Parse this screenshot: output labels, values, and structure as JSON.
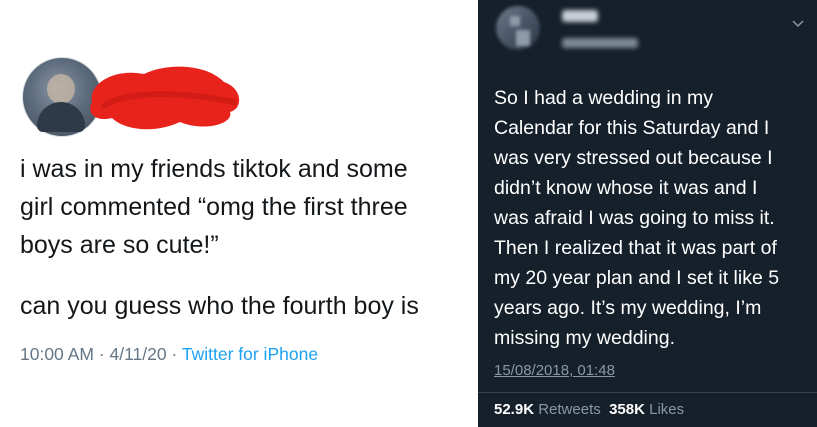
{
  "left_tweet": {
    "text_line1": "i was in my friends tiktok and some",
    "text_line2": "girl commented “omg the first three",
    "text_line3": "boys are so cute!”",
    "text_para2": "can you guess who the fourth boy is",
    "time": "10:00 AM",
    "separator": "·",
    "date": "4/11/20",
    "source": "Twitter for iPhone",
    "redaction_color": "#e8231c",
    "link_color": "#1da1f2"
  },
  "right_tweet": {
    "text_lines": [
      "So I had a wedding in my",
      "Calendar for this Saturday and I",
      "was very stressed out because I",
      "didn’t know whose it was and I",
      "was afraid I was going to miss it.",
      "Then I realized that it was part of",
      "my 20 year plan and I set it like 5",
      "years ago. It’s my wedding, I’m",
      "missing my wedding."
    ],
    "timestamp": "15/08/2018, 01:48",
    "retweets_count": "52.9K",
    "retweets_label": "Retweets",
    "likes_count": "358K",
    "likes_label": "Likes",
    "background_color": "#15202b"
  },
  "icons": [
    "chevron-down-icon",
    "avatar"
  ]
}
